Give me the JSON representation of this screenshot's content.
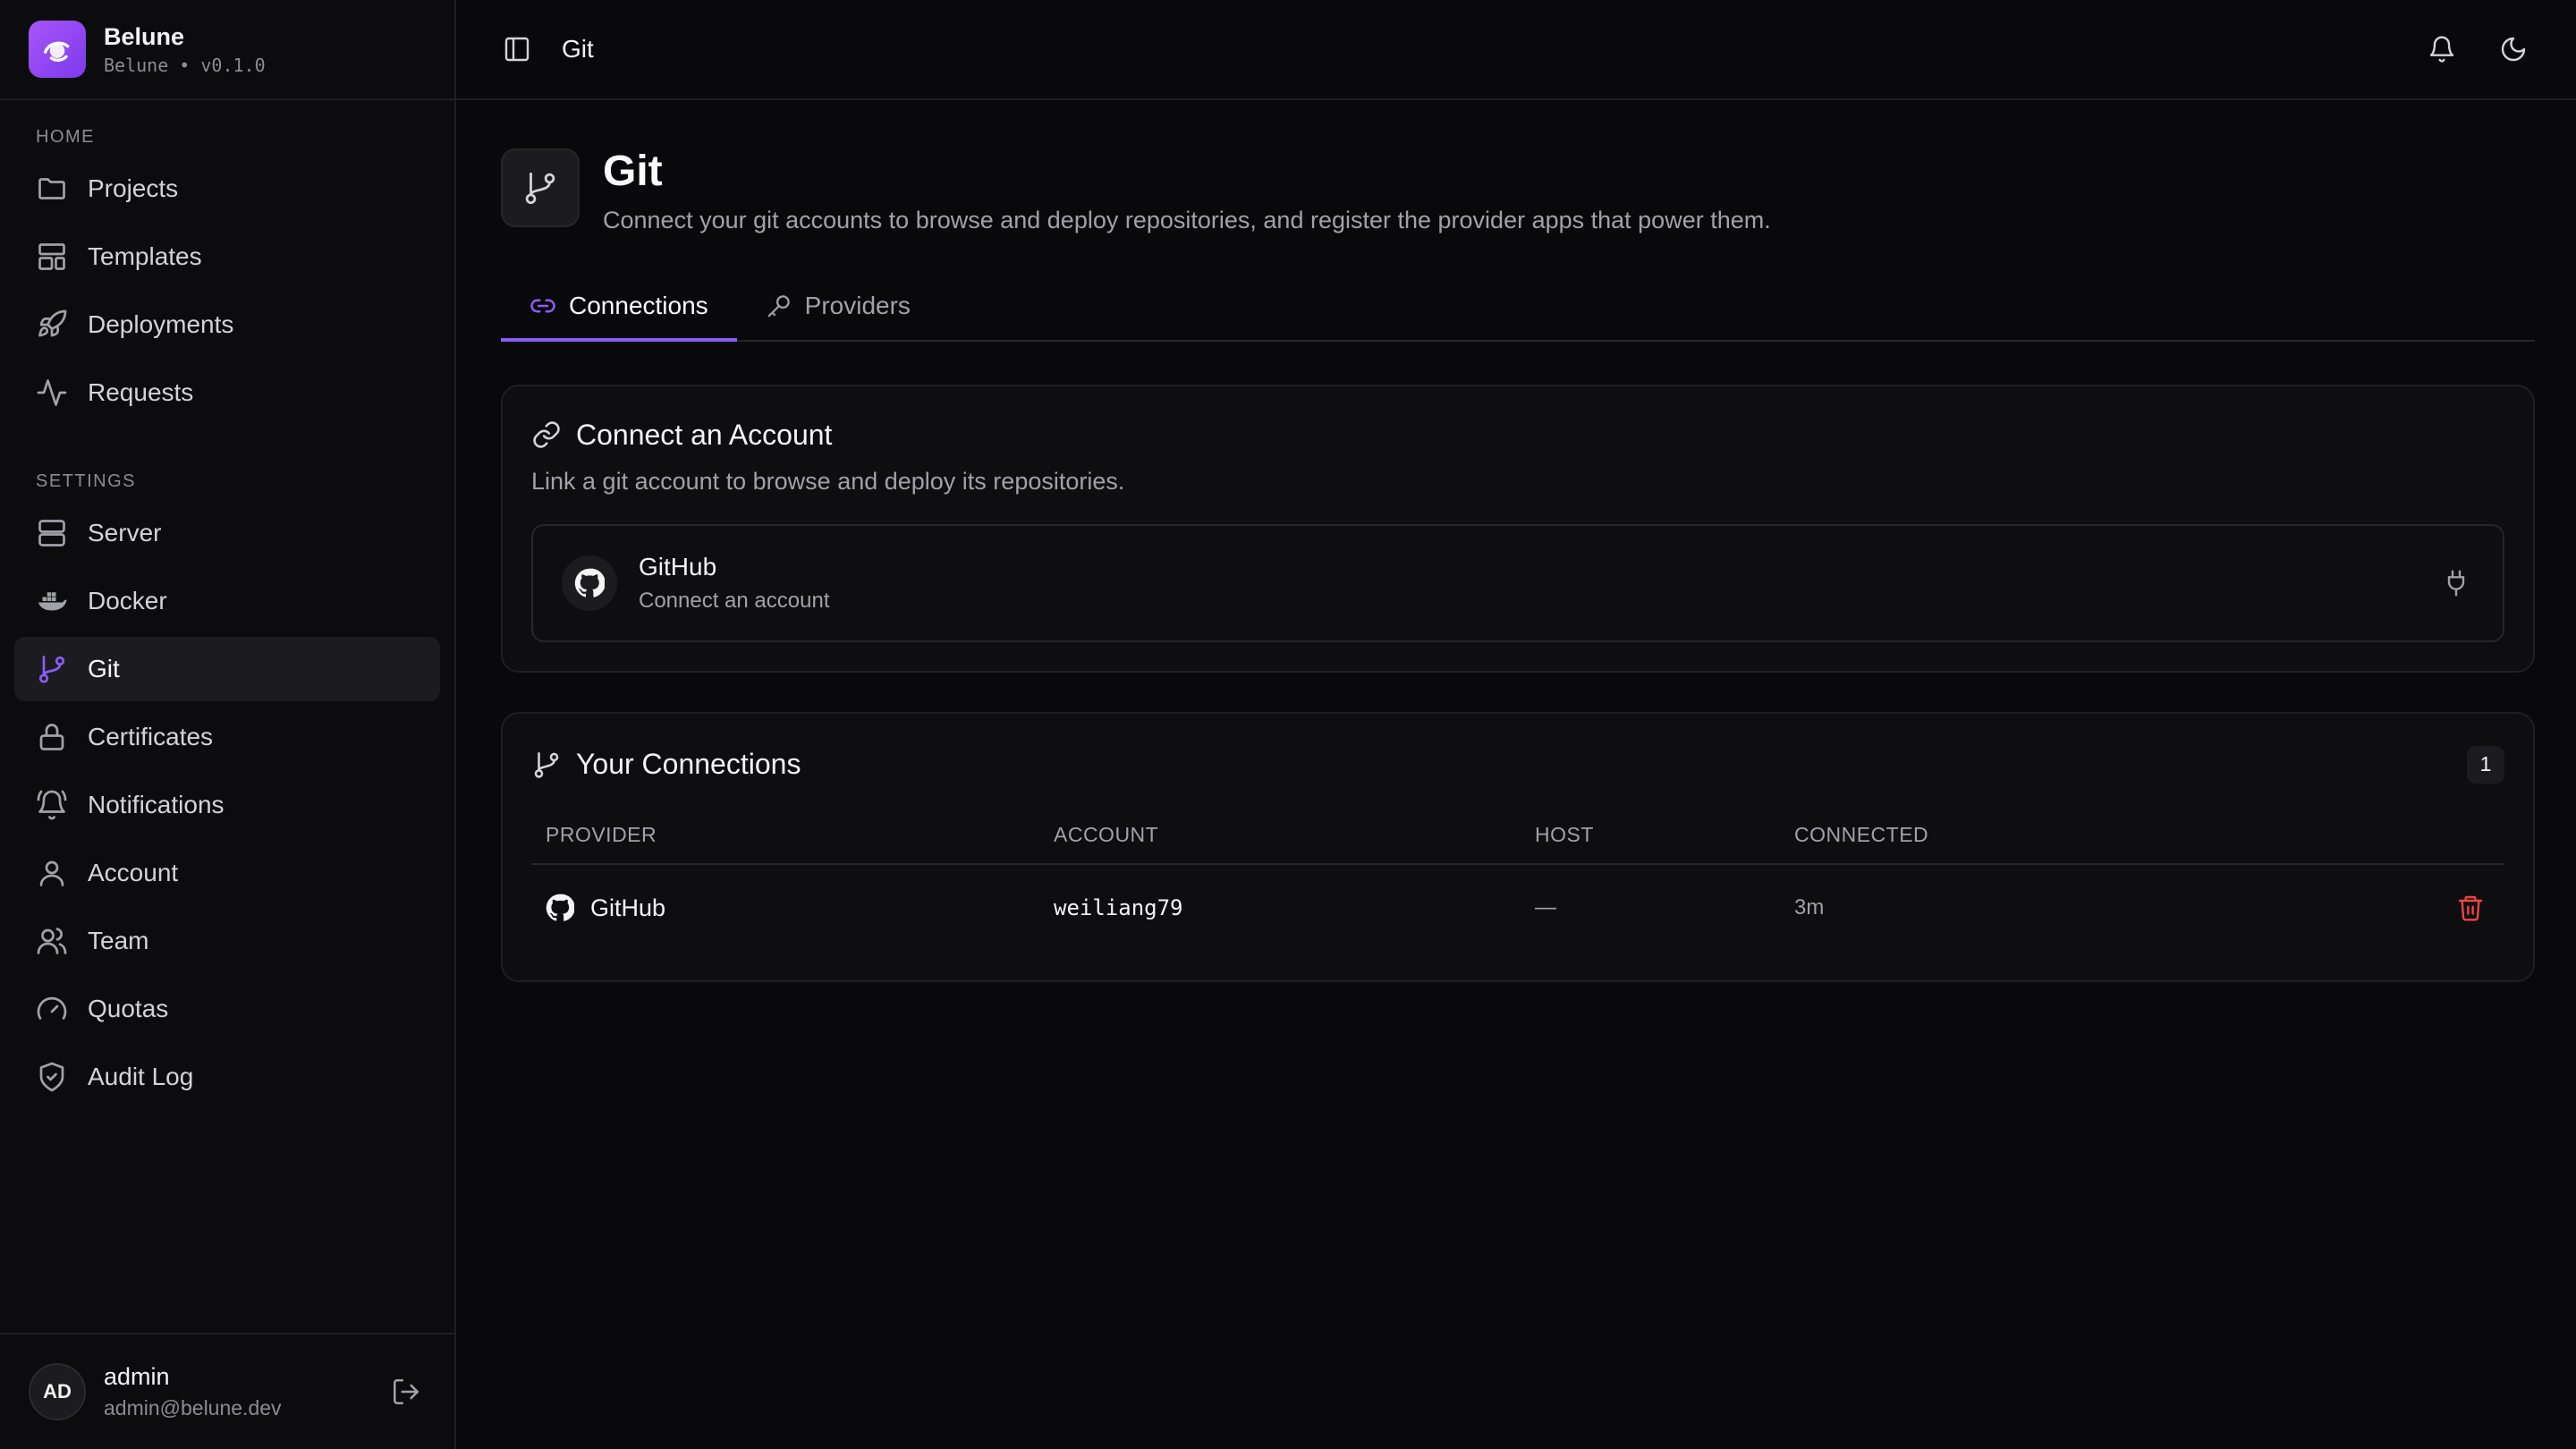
{
  "brand": {
    "name": "Belune",
    "subtitle": "Belune • v0.1.0"
  },
  "nav": {
    "home_label": "HOME",
    "settings_label": "SETTINGS",
    "home_items": [
      "Projects",
      "Templates",
      "Deployments",
      "Requests"
    ],
    "settings_items": [
      "Server",
      "Docker",
      "Git",
      "Certificates",
      "Notifications",
      "Account",
      "Team",
      "Quotas",
      "Audit Log"
    ],
    "active": "Git"
  },
  "user": {
    "initials": "AD",
    "name": "admin",
    "email": "admin@belune.dev"
  },
  "topbar": {
    "title": "Git"
  },
  "page": {
    "title": "Git",
    "description": "Connect your git accounts to browse and deploy repositories, and register the provider apps that power them."
  },
  "tabs": [
    "Connections",
    "Providers"
  ],
  "connect_card": {
    "title": "Connect an Account",
    "description": "Link a git account to browse and deploy its repositories.",
    "provider": {
      "name": "GitHub",
      "subtitle": "Connect an account"
    }
  },
  "connections_card": {
    "title": "Your Connections",
    "count": "1",
    "columns": [
      "PROVIDER",
      "ACCOUNT",
      "HOST",
      "CONNECTED"
    ],
    "rows": [
      {
        "provider": "GitHub",
        "account": "weiliang79",
        "host": "—",
        "connected": "3m"
      }
    ]
  },
  "colors": {
    "accent": "#8b5cf6",
    "danger": "#ef4444",
    "background": "#09090b"
  }
}
